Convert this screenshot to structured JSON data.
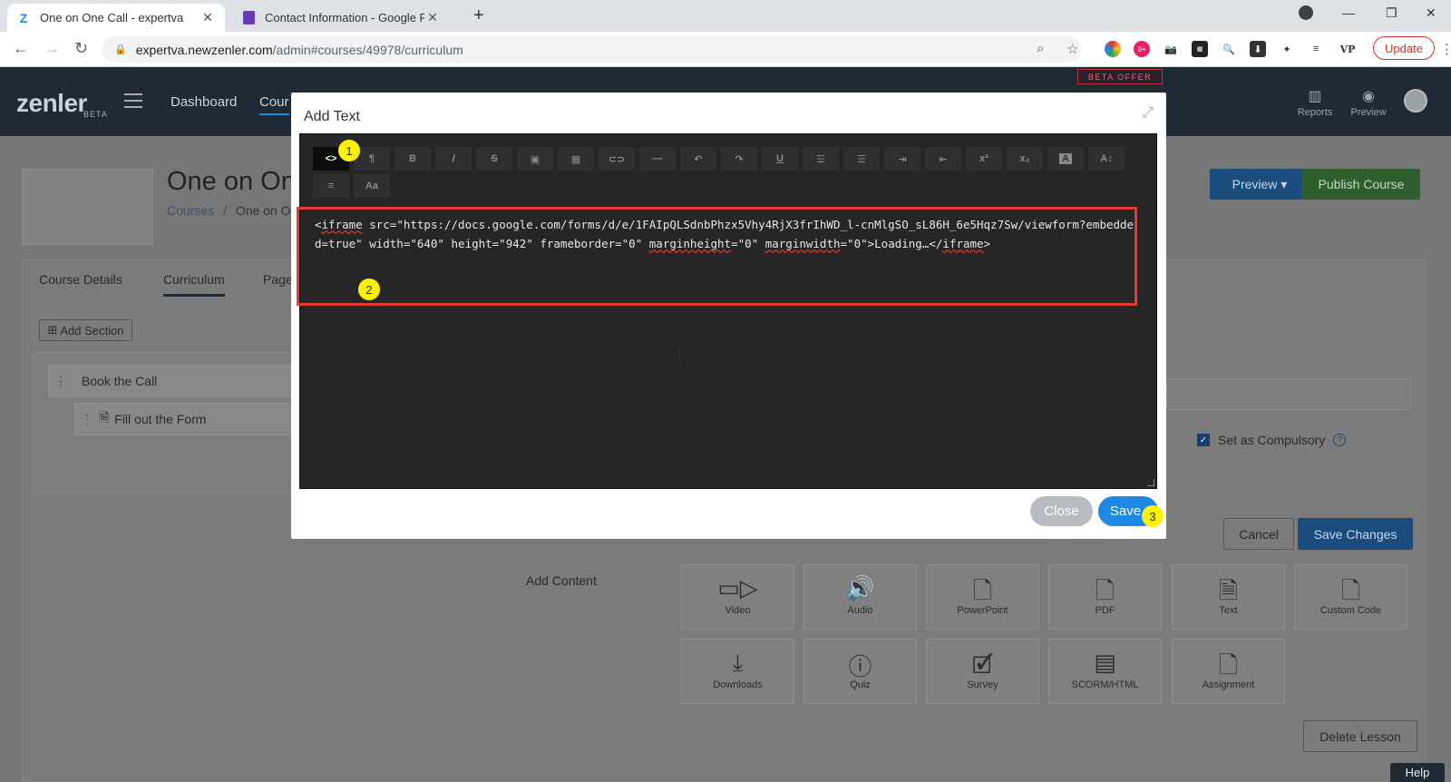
{
  "browser": {
    "tabs": [
      {
        "title": "One on One Call - expertva",
        "active": true
      },
      {
        "title": "Contact Information - Google Fo",
        "active": false
      }
    ],
    "url_host": "expertva.newzenler.com",
    "url_path": "/admin#courses/49978/curriculum",
    "update_label": "Update",
    "ext_badge": "9+",
    "ext_vp": "VP"
  },
  "app": {
    "logo": "zenler",
    "logo_sub": "BETA",
    "nav": [
      "Dashboard",
      "Cour"
    ],
    "beta_offer": "BETA OFFER",
    "reports_label": "Reports",
    "preview_label": "Preview",
    "course_title": "One on On",
    "breadcrumb_courses": "Courses",
    "breadcrumb_sep": "/",
    "breadcrumb_current": "One on O",
    "preview_button": "Preview ▾",
    "publish_button": "Publish Course",
    "tabs": [
      "Course Details",
      "Curriculum",
      "Page"
    ],
    "add_section": "Add Section",
    "section_title": "Book the Call",
    "lesson_title": "Fill out the Form",
    "set_compulsory": "Set as Compulsory",
    "cancel_button": "Cancel",
    "save_changes_button": "Save Changes",
    "add_content_label": "Add Content",
    "content_tiles": [
      {
        "label": "Video",
        "icon": "video-icon"
      },
      {
        "label": "Audio",
        "icon": "audio-icon"
      },
      {
        "label": "PowerPoint",
        "icon": "powerpoint-icon"
      },
      {
        "label": "PDF",
        "icon": "pdf-icon"
      },
      {
        "label": "Text",
        "icon": "text-doc-icon"
      },
      {
        "label": "Custom Code",
        "icon": "code-file-icon"
      },
      {
        "label": "Downloads",
        "icon": "download-icon"
      },
      {
        "label": "Quiz",
        "icon": "question-icon"
      },
      {
        "label": "Survey",
        "icon": "survey-icon"
      },
      {
        "label": "SCORM/HTML",
        "icon": "scorm-icon"
      },
      {
        "label": "Assignment",
        "icon": "assignment-icon"
      }
    ],
    "delete_lesson": "Delete Lesson",
    "help": "Help"
  },
  "modal": {
    "title": "Add Text",
    "toolbar_row1": [
      "<>",
      "¶",
      "B",
      "I",
      "S",
      "img",
      "tbl",
      "link",
      "—",
      "↶",
      "↷",
      "U",
      "ol",
      "ul",
      "indent",
      "outdent",
      "x²",
      "x₂",
      "A",
      "A↕"
    ],
    "toolbar_row2": [
      "align",
      "Aa"
    ],
    "code_part1": "<",
    "code_u1": "iframe",
    "code_part2": " src=\"https://docs.google.com/forms/d/e/1FAIpQLSdnbPhzx5Vhy4RjX3frIhWD_l-cnMlgSO_sL86H_6e5Hqz7Sw/viewform?embedded=true\" width=\"640\" height=\"942\" frameborder=\"0\" ",
    "code_u2": "marginheight",
    "code_part3": "=\"0\" ",
    "code_u3": "marginwidth",
    "code_part4": "=\"0\">Loading…</",
    "code_u4": "iframe",
    "code_part5": ">",
    "close_button": "Close",
    "save_button": "Save"
  },
  "annotations": {
    "badge1": "1",
    "badge2": "2",
    "badge3": "3"
  },
  "colors": {
    "accent_blue": "#1e88e5",
    "publish_green": "#3a7d3a",
    "annotation_yellow": "#fff200",
    "highlight_red": "#e53935",
    "editor_bg": "#262626"
  }
}
